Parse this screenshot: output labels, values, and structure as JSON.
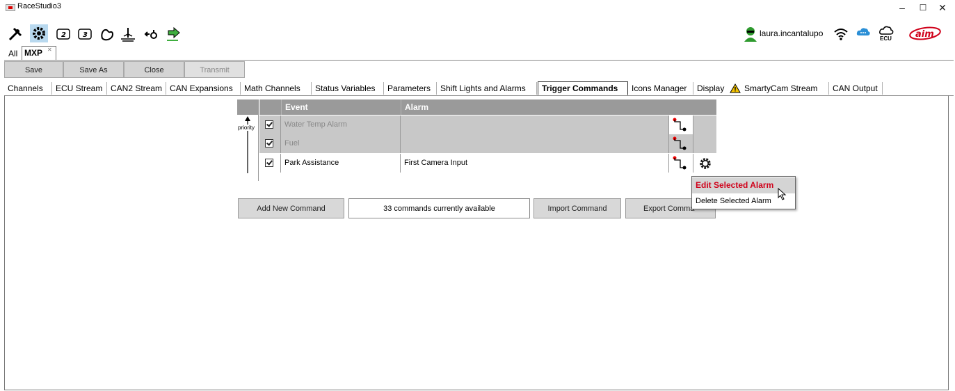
{
  "window": {
    "title": "RaceStudio3",
    "minimize": "–",
    "maximize": "☐",
    "close": "✕"
  },
  "toolbar": {
    "icons": [
      "wrench-icon",
      "gear-icon",
      "device-2-icon",
      "device-3-icon",
      "track-map-icon",
      "water-level-icon",
      "transfer-icon",
      "download-icon"
    ],
    "user": "laura.incantalupo",
    "ecu_label": "ECU"
  },
  "file_tabs": {
    "all": "All",
    "current": "MXP"
  },
  "buttons": {
    "save": "Save",
    "save_as": "Save As",
    "close": "Close",
    "transmit": "Transmit"
  },
  "tabs": [
    "Channels",
    "ECU Stream",
    "CAN2 Stream",
    "CAN Expansions",
    "Math Channels",
    "Status Variables",
    "Parameters",
    "Shift Lights and Alarms",
    "Trigger Commands",
    "Icons Manager",
    "Display",
    "SmartyCam Stream",
    "CAN Output"
  ],
  "table": {
    "headers": {
      "event": "Event",
      "alarm": "Alarm"
    },
    "priority_label": "priority",
    "rows": [
      {
        "event": "Water Temp Alarm",
        "alarm": "",
        "enabled": true,
        "disabled_row": true
      },
      {
        "event": "Fuel",
        "alarm": "",
        "enabled": true,
        "disabled_row": true
      },
      {
        "event": "Park Assistance",
        "alarm": "First Camera Input",
        "enabled": true,
        "disabled_row": false
      }
    ]
  },
  "actions": {
    "add": "Add New Command",
    "counter": "33 commands currently available",
    "import": "Import Command",
    "export": "Export Comma"
  },
  "context_menu": {
    "edit": "Edit Selected Alarm",
    "delete": "Delete Selected Alarm"
  },
  "colors": {
    "accent_red": "#d0021b",
    "header_gray": "#9a9a9a",
    "button_gray": "#d4d4d4"
  }
}
